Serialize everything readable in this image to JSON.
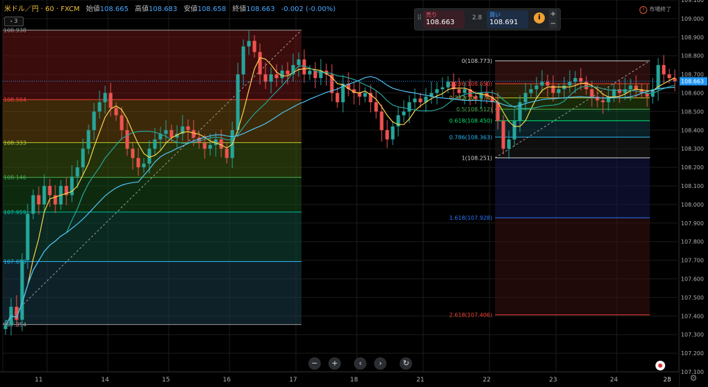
{
  "header": {
    "symbol": "米ドル／円 · 60 · FXCM",
    "open_label": "始値",
    "open": "108.665",
    "high_label": "高値",
    "high": "108.683",
    "low_label": "安値",
    "low": "108.658",
    "close_label": "終値",
    "close": "108.663",
    "change": "-0.002 (-0.00%)",
    "collapse_label": "3"
  },
  "trade_panel": {
    "sell_label": "売り",
    "sell_price": "108.663",
    "spread": "2.8",
    "buy_label": "買い",
    "buy_price": "108.691",
    "info_label": "i",
    "plus_label": "+",
    "minus_label": "−"
  },
  "market_status": {
    "icon": "clock-icon",
    "label": "市場終了"
  },
  "price_axis": {
    "min": 107.1,
    "max": 109.1,
    "ticks": [
      "109.100",
      "109.000",
      "108.900",
      "108.800",
      "108.700",
      "108.600",
      "108.500",
      "108.400",
      "108.300",
      "108.200",
      "108.100",
      "108.000",
      "107.900",
      "107.800",
      "107.700",
      "107.600",
      "107.500",
      "107.400",
      "107.300",
      "107.200",
      "107.100"
    ],
    "current_label": "108.663",
    "current_value": 108.663,
    "current_color": "#2196f3"
  },
  "time_axis": {
    "labels": [
      "11",
      "14",
      "15",
      "16",
      "17",
      "18",
      "21",
      "22",
      "23",
      "24",
      "25",
      "28"
    ]
  },
  "fib_left": {
    "from_index": 0,
    "to_index": 53,
    "high": 108.938,
    "low": 107.354,
    "labels": [
      {
        "text": "108.938",
        "level": 0,
        "color": "#9e9e9e"
      },
      {
        "text": "108.564",
        "level": 0.236,
        "color": "#f44336"
      },
      {
        "text": "108.333",
        "level": 0.382,
        "color": "#c0ca33"
      },
      {
        "text": "108.146",
        "level": 0.5,
        "color": "#4caf50"
      },
      {
        "text": "107.959",
        "level": 0.618,
        "color": "#00bfa5"
      },
      {
        "text": "107.693",
        "level": 0.786,
        "color": "#29b6f6"
      },
      {
        "text": "107.354",
        "level": 1,
        "color": "#9e9e9e"
      }
    ]
  },
  "fib_right": {
    "from_index": 89,
    "to_index": 116,
    "high": 108.773,
    "low": 108.251,
    "levels": [
      {
        "text": "0(108.773)",
        "level": 0,
        "color": "#cfcfcf"
      },
      {
        "text": "0.236(108.650)",
        "level": 0.236,
        "color": "#f44336"
      },
      {
        "text": "0.382(108.574)",
        "level": 0.382,
        "color": "#c0ca33"
      },
      {
        "text": "0.5(108.512)",
        "level": 0.5,
        "color": "#4caf50"
      },
      {
        "text": "0.618(108.450)",
        "level": 0.618,
        "color": "#00e676"
      },
      {
        "text": "0.786(108.363)",
        "level": 0.786,
        "color": "#29b6f6"
      },
      {
        "text": "1(108.251)",
        "level": 1,
        "color": "#cfcfcf"
      },
      {
        "text": "1.618(107.928)",
        "level": 1.618,
        "color": "#2979ff"
      },
      {
        "text": "2.618(107.406)",
        "level": 2.618,
        "color": "#f44336"
      }
    ]
  },
  "navigation": {
    "zoom_out": "−",
    "zoom_in": "+",
    "scroll_left": "‹",
    "scroll_right": "›",
    "reset": "↻"
  },
  "colors": {
    "up": "#26a69a",
    "down": "#ef5350",
    "ma_fast": "#ffd54f",
    "ma_mid": "#26a69a",
    "ma_slow": "#4fc3f7"
  },
  "chart_data": {
    "type": "candlestick",
    "title": "米ドル／円 · 60 · FXCM",
    "ylim": [
      107.1,
      109.1
    ],
    "x_day_labels": [
      "11",
      "14",
      "15",
      "16",
      "17",
      "18",
      "21",
      "22",
      "23",
      "24",
      "25",
      "28"
    ],
    "close": [
      107.35,
      107.45,
      107.38,
      107.7,
      107.95,
      108.05,
      108.0,
      108.1,
      108.05,
      108.0,
      108.1,
      108.05,
      108.15,
      108.2,
      108.3,
      108.4,
      108.5,
      108.55,
      108.6,
      108.52,
      108.48,
      108.4,
      108.3,
      108.25,
      108.2,
      108.22,
      108.3,
      108.35,
      108.38,
      108.4,
      108.36,
      108.38,
      108.42,
      108.4,
      108.36,
      108.33,
      108.3,
      108.32,
      108.35,
      108.3,
      108.25,
      108.4,
      108.7,
      108.85,
      108.88,
      108.82,
      108.7,
      108.66,
      108.7,
      108.68,
      108.72,
      108.7,
      108.75,
      108.78,
      108.7,
      108.72,
      108.68,
      108.72,
      108.7,
      108.6,
      108.55,
      108.65,
      108.62,
      108.6,
      108.58,
      108.6,
      108.55,
      108.5,
      108.4,
      108.35,
      108.42,
      108.48,
      108.5,
      108.55,
      108.57,
      108.55,
      108.58,
      108.6,
      108.62,
      108.63,
      108.66,
      108.62,
      108.6,
      108.62,
      108.58,
      108.57,
      108.6,
      108.58,
      108.55,
      108.45,
      108.3,
      108.35,
      108.45,
      108.55,
      108.6,
      108.62,
      108.64,
      108.66,
      108.64,
      108.6,
      108.62,
      108.64,
      108.66,
      108.68,
      108.66,
      108.62,
      108.58,
      108.56,
      108.55,
      108.58,
      108.62,
      108.6,
      108.62,
      108.64,
      108.62,
      108.6,
      108.58,
      108.62,
      108.75,
      108.7,
      108.68,
      108.663
    ]
  }
}
